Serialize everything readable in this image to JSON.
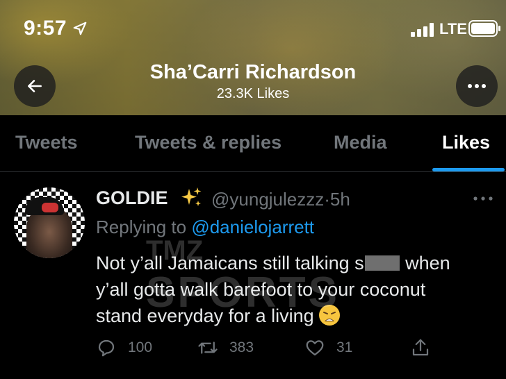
{
  "status_bar": {
    "time": "9:57",
    "network": "LTE"
  },
  "profile": {
    "name": "Sha’Carri Richardson",
    "likes_count": "23.3K Likes"
  },
  "tabs": [
    {
      "label": "Tweets",
      "active": false
    },
    {
      "label": "Tweets & replies",
      "active": false
    },
    {
      "label": "Media",
      "active": false
    },
    {
      "label": "Likes",
      "active": true
    }
  ],
  "tweet": {
    "author_name": "GOLDIE",
    "author_handle": "@yungjulezzz",
    "separator": "·",
    "age": "5h",
    "reply_prefix": "Replying to ",
    "reply_to": "@danielojarrett",
    "body_lines": [
      {
        "before": "Not y’all Jamaicans still talking s",
        "after": " when"
      },
      "y’all gotta walk barefoot to your coconut",
      "stand everyday for a living"
    ],
    "counts": {
      "replies": "100",
      "retweets": "383",
      "likes": "31"
    }
  },
  "watermark": {
    "logo_text": "TMZ",
    "sub_text": "SPORTS"
  },
  "colors": {
    "accent": "#1d9bf0",
    "muted": "#71767b",
    "text": "#e7e9ea",
    "background": "#000000"
  },
  "icons": [
    "location-arrow-icon",
    "signal-bars-icon",
    "battery-icon",
    "back-arrow-icon",
    "more-dots-icon",
    "sparkles-icon",
    "weary-face-emoji-icon",
    "reply-icon",
    "retweet-icon",
    "heart-icon",
    "share-icon"
  ]
}
